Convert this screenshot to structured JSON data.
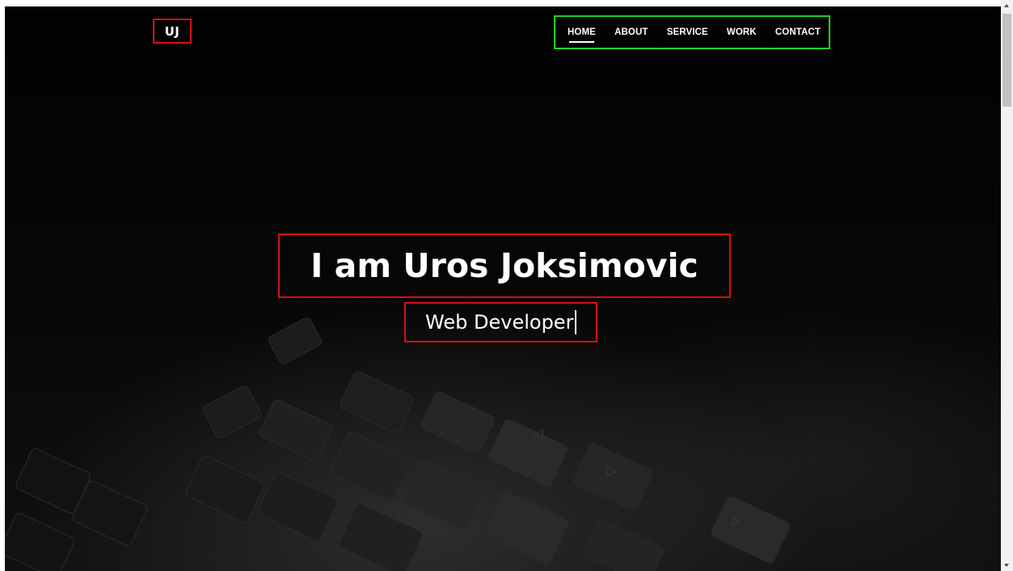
{
  "brand": {
    "logo_text": "UJ"
  },
  "nav": {
    "items": [
      {
        "label": "HOME",
        "active": true
      },
      {
        "label": "ABOUT",
        "active": false
      },
      {
        "label": "SERVICE",
        "active": false
      },
      {
        "label": "WORK",
        "active": false
      },
      {
        "label": "CONTACT",
        "active": false
      }
    ]
  },
  "hero": {
    "title": "I am Uros Joksimovic",
    "subtitle": "Web Developer"
  },
  "colors": {
    "background": "#050505",
    "text": "#ffffff",
    "highlight_red": "#d90f0f",
    "highlight_green": "#1fd11f"
  }
}
